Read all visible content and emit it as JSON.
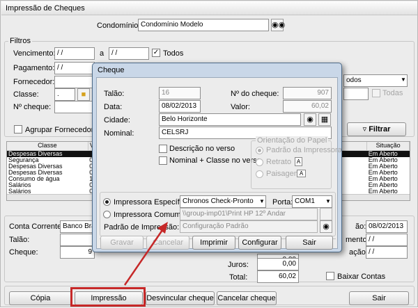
{
  "window": {
    "title": "Impressão de Cheques"
  },
  "condominio": {
    "label": "Condomínio:",
    "value": "Condomínio Modelo"
  },
  "filtros": {
    "title": "Filtros",
    "vencimento": {
      "label": "Vencimento:",
      "from": "/ /",
      "sep": "a",
      "to": "/ /",
      "todos": "Todos"
    },
    "pagamento": {
      "label": "Pagamento:",
      "from": "/ /"
    },
    "fornecedor": {
      "label": "Fornecedor:",
      "value_right": "odos"
    },
    "classe": {
      "label": "Classe:",
      "value": ".",
      "todas": "Todas"
    },
    "ncheque": {
      "label": "Nº cheque:"
    },
    "agrupar": "Agrupar Fornecedores",
    "filtrar": "Filtrar"
  },
  "grid": {
    "columns": [
      "Classe",
      "V",
      "Situação"
    ],
    "rows": [
      {
        "classe": "Despesas Diversas",
        "v": "",
        "sit": "Em Aberto",
        "selected": true
      },
      {
        "classe": "Segurança",
        "v": "0",
        "sit": "Em Aberto",
        "selected": false
      },
      {
        "classe": "Despesas Diversas",
        "v": "0",
        "sit": "Em Aberto",
        "selected": false
      },
      {
        "classe": "Despesas Diversas",
        "v": "0",
        "sit": "Em Aberto",
        "selected": false
      },
      {
        "classe": "Consumo de água",
        "v": "1",
        "sit": "Em Aberto",
        "selected": false
      },
      {
        "classe": "Salários",
        "v": "0",
        "sit": "Em Aberto",
        "selected": false
      },
      {
        "classe": "Salários",
        "v": "0",
        "sit": "Em Aberto",
        "selected": false
      }
    ]
  },
  "bottom": {
    "conta_label": "Conta Corrente:",
    "conta_value": "Banco Brad",
    "talao_label": "Talão:",
    "cheque_label": "Cheque:",
    "cheque_value": "9",
    "data_label_suffix": "ão:",
    "data_value": "08/02/2013",
    "mento_label": "mento:",
    "mento_value": "/ /",
    "acao_label": "ação:",
    "acao_value": "/ /",
    "juros_label": "Juros:",
    "juros_value": "0,00",
    "total_label": "Total:",
    "total_value": "60,02",
    "desconto_value": "0,00",
    "baixar": "Baixar Contas"
  },
  "footer": {
    "copia": "Cópia",
    "impressao": "Impressão",
    "desvincular": "Desvincular cheque",
    "cancelar": "Cancelar cheque",
    "sair": "Sair"
  },
  "dialog": {
    "title": "Cheque",
    "talao_label": "Talão:",
    "talao_value": "16",
    "data_label": "Data:",
    "data_value": "08/02/2013",
    "ncheque_label": "Nº do cheque:",
    "ncheque_value": "907",
    "valor_label": "Valor:",
    "valor_value": "60,02",
    "cidade_label": "Cidade:",
    "cidade_value": "Belo Horizonte",
    "nominal_label": "Nominal:",
    "nominal_value": "CELSRJ",
    "desc_verso": "Descrição no verso",
    "nominal_classe": "Nominal + Classe no verso",
    "orientacao": {
      "title": "Orientação do Papel",
      "padrao": "Padrão da Impressora",
      "retrato": "Retrato",
      "paisagem": "Paisagem"
    },
    "imp_especifica": "Impressora Específica:",
    "imp_especifica_value": "Chronos Check-Pronto",
    "porta_label": "Porta:",
    "porta_value": "COM1",
    "imp_comum": "Impressora Comum:",
    "imp_comum_value": "\\\\group-imp01\\Print HP 12º Andar",
    "padrao_label": "Padrão de Impressão:",
    "padrao_value": "Configuração Padrão",
    "buttons": {
      "gravar": "Gravar",
      "cancelar": "Cancelar",
      "imprimir": "Imprimir",
      "configurar": "Configurar",
      "sair": "Sair"
    }
  }
}
